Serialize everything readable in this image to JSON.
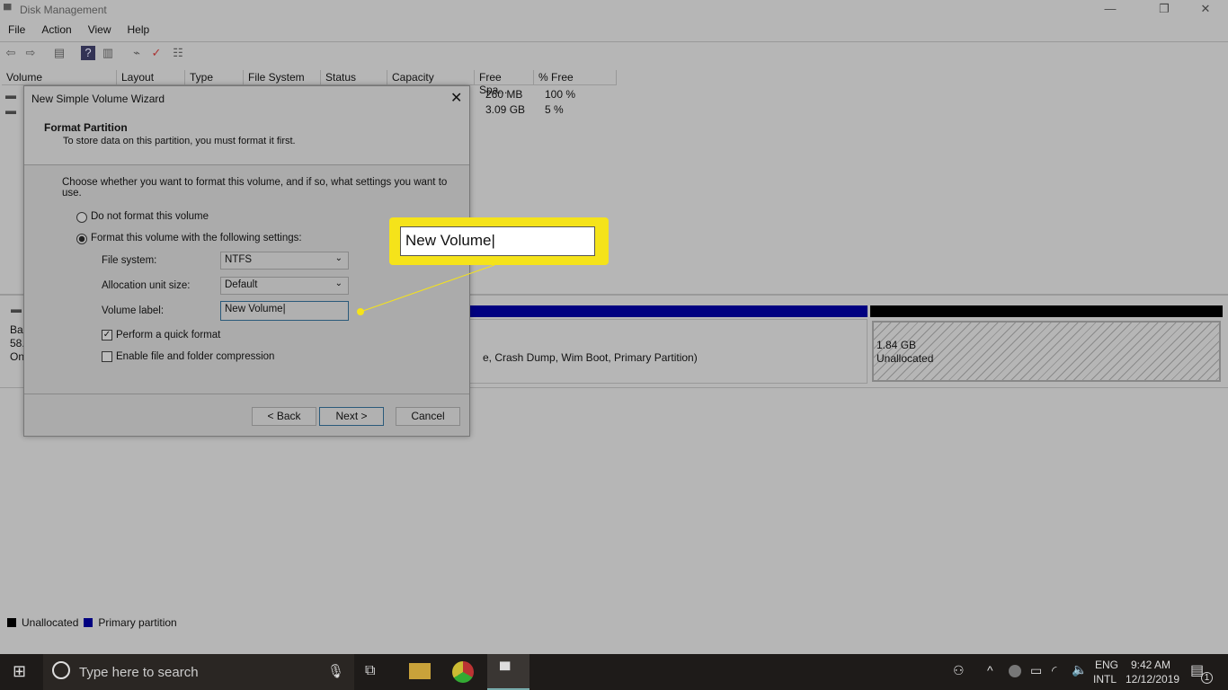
{
  "window": {
    "title": "Disk Management",
    "icon": "disk-management-icon"
  },
  "menu": [
    "File",
    "Action",
    "View",
    "Help"
  ],
  "toolbar_icons": [
    "back-icon",
    "forward-icon",
    "console-tree-icon",
    "help-icon",
    "action-pane-icon",
    "connect-icon",
    "check-icon",
    "properties-icon"
  ],
  "columns": [
    "Volume",
    "Layout",
    "Type",
    "File System",
    "Status",
    "Capacity",
    "Free Spa...",
    "% Free"
  ],
  "rows": [
    {
      "free": "260 MB",
      "pct": "100 %"
    },
    {
      "free": "3.09 GB",
      "pct": "5 %"
    }
  ],
  "disk": {
    "label_fragments": [
      "Ba",
      "58.",
      "On"
    ],
    "partition_text": "e, Crash Dump, Wim Boot, Primary Partition)",
    "unalloc_size": "1.84 GB",
    "unalloc_label": "Unallocated"
  },
  "legend": [
    {
      "label": "Unallocated",
      "color": "#000000"
    },
    {
      "label": "Primary partition",
      "color": "#000080"
    }
  ],
  "dialog": {
    "title": "New Simple Volume Wizard",
    "heading": "Format Partition",
    "subheading": "To store data on this partition, you must format it first.",
    "instruction": "Choose whether you want to format this volume, and if so, what settings you want to use.",
    "radio_no_format": "Do not format this volume",
    "radio_format": "Format this volume with the following settings:",
    "selected_radio": "format",
    "file_system_label": "File system:",
    "file_system_value": "NTFS",
    "alloc_label": "Allocation unit size:",
    "alloc_value": "Default",
    "volume_label_label": "Volume label:",
    "volume_label_value": "New Volume",
    "quick_format": "Perform a quick format",
    "quick_format_checked": true,
    "compression": "Enable file and folder compression",
    "compression_checked": false,
    "back": "< Back",
    "next": "Next >",
    "cancel": "Cancel"
  },
  "callout": {
    "text": "New Volume",
    "color": "#f5e31a"
  },
  "taskbar": {
    "search_placeholder": "Type here to search",
    "lang1": "ENG",
    "lang2": "INTL",
    "time": "9:42 AM",
    "date": "12/12/2019",
    "notification_count": "1"
  }
}
